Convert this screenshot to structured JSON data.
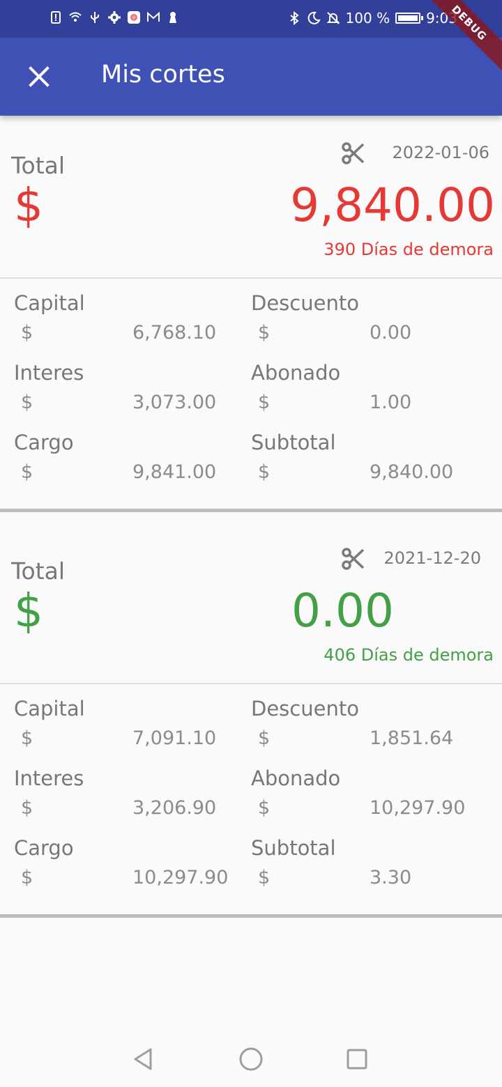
{
  "status_bar": {
    "left_icons": [
      "alert-icon",
      "wifi-icon",
      "usb-icon",
      "settings-icon",
      "app-icon",
      "gmail-icon",
      "keyhole-icon"
    ],
    "right_icons": [
      "bluetooth-icon",
      "moon-icon",
      "bell-off-icon"
    ],
    "battery": "100 %",
    "time": "9:03"
  },
  "app_bar": {
    "title": "Mis cortes",
    "background": "#3f51b5"
  },
  "debug_banner": "DEBUG",
  "cortes": [
    {
      "date": "2022-01-06",
      "total_label": "Total",
      "currency": "$",
      "total": "9,840.00",
      "delay": "390 Días de demora",
      "status_color": "#e53935",
      "items": [
        {
          "label": "Capital",
          "currency": "$",
          "value": "6,768.10"
        },
        {
          "label": "Descuento",
          "currency": "$",
          "value": "0.00"
        },
        {
          "label": "Interes",
          "currency": "$",
          "value": "3,073.00"
        },
        {
          "label": "Abonado",
          "currency": "$",
          "value": "1.00"
        },
        {
          "label": "Cargo",
          "currency": "$",
          "value": "9,841.00"
        },
        {
          "label": "Subtotal",
          "currency": "$",
          "value": "9,840.00"
        }
      ]
    },
    {
      "date": "2021-12-20",
      "total_label": "Total",
      "currency": "$",
      "total": "0.00",
      "delay": "406 Días de demora",
      "status_color": "#43a047",
      "items": [
        {
          "label": "Capital",
          "currency": "$",
          "value": "7,091.10"
        },
        {
          "label": "Descuento",
          "currency": "$",
          "value": "1,851.64"
        },
        {
          "label": "Interes",
          "currency": "$",
          "value": "3,206.90"
        },
        {
          "label": "Abonado",
          "currency": "$",
          "value": "10,297.90"
        },
        {
          "label": "Cargo",
          "currency": "$",
          "value": "10,297.90"
        },
        {
          "label": "Subtotal",
          "currency": "$",
          "value": "3.30"
        }
      ]
    }
  ],
  "nav_bar": [
    "back-icon",
    "home-icon",
    "recents-icon"
  ]
}
